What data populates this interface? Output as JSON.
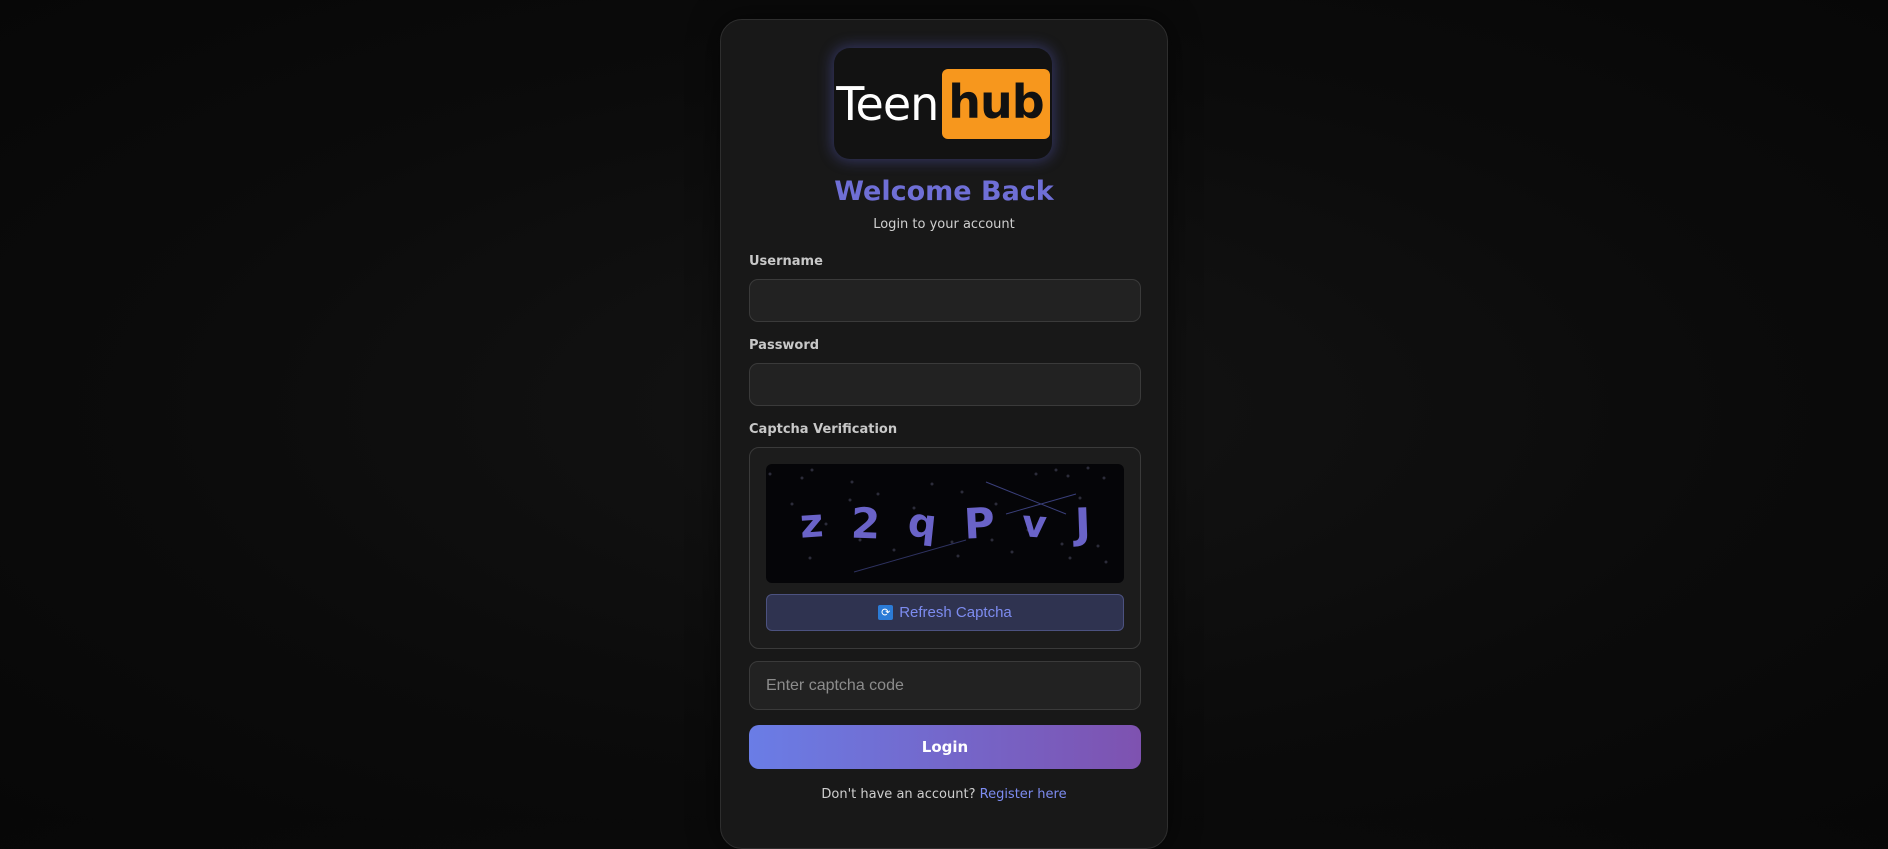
{
  "logo": {
    "part1": "Teen",
    "part2": "hub"
  },
  "header": {
    "title": "Welcome Back",
    "subtitle": "Login to your account"
  },
  "form": {
    "username_label": "Username",
    "username_value": "",
    "password_label": "Password",
    "password_value": "",
    "captcha_label": "Captcha Verification",
    "captcha_text": [
      "z",
      "2",
      "q",
      "P",
      "v",
      "J"
    ],
    "refresh_label": "Refresh Captcha",
    "captcha_placeholder": "Enter captcha code",
    "login_label": "Login"
  },
  "footer": {
    "text": "Don't have an account?",
    "link": "Register here"
  },
  "colors": {
    "accent": "#6f6fd6",
    "logo_orange": "#f7971d",
    "gradient_start": "#6a7de6",
    "gradient_end": "#7e52b0"
  },
  "icons": {
    "refresh": "refresh-icon"
  }
}
